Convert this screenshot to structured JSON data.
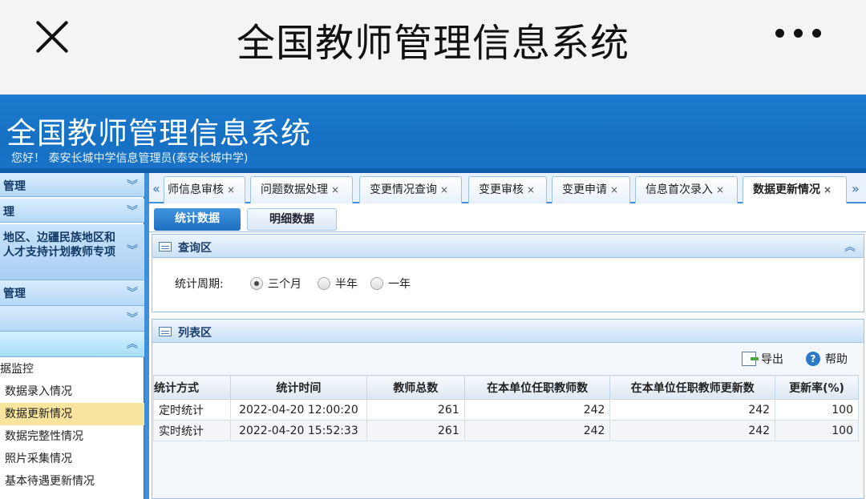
{
  "mobile": {
    "title": "全国教师管理信息系统"
  },
  "banner": {
    "title": "全国教师管理信息系统",
    "greeting": "您好！ 泰安长城中学信息管理员(泰安长城中学)"
  },
  "sidebar": {
    "heads": [
      "管理",
      "理",
      "管理",
      "",
      ""
    ],
    "block_lines": [
      "地区、边疆民族地区和",
      "人才支持计划教师专项"
    ],
    "items": [
      "据监控",
      "数据录入情况",
      "数据更新情况",
      "数据完整性情况",
      "照片采集情况",
      "基本待遇更新情况"
    ]
  },
  "tabs": {
    "labels": [
      "师信息审核",
      "问题数据处理",
      "变更情况查询",
      "变更审核",
      "变更申请",
      "信息首次录入",
      "数据更新情况"
    ],
    "close": "×",
    "prev": "«",
    "next": "»"
  },
  "subtabs": {
    "stat": "统计数据",
    "detail": "明细数据"
  },
  "query": {
    "title": "查询区",
    "period_label": "统计周期:",
    "options": [
      "三个月",
      "半年",
      "一年"
    ],
    "selected": 0
  },
  "list": {
    "title": "列表区",
    "export": "导出",
    "help": "帮助",
    "columns": [
      "统计方式",
      "统计时间",
      "教师总数",
      "在本单位任职教师数",
      "在本单位任职教师更新数",
      "更新率(%)"
    ],
    "rows": [
      [
        "定时统计",
        "2022-04-20 12:00:20",
        "261",
        "242",
        "242",
        "100"
      ],
      [
        "实时统计",
        "2022-04-20 15:52:33",
        "261",
        "242",
        "242",
        "100"
      ]
    ]
  }
}
